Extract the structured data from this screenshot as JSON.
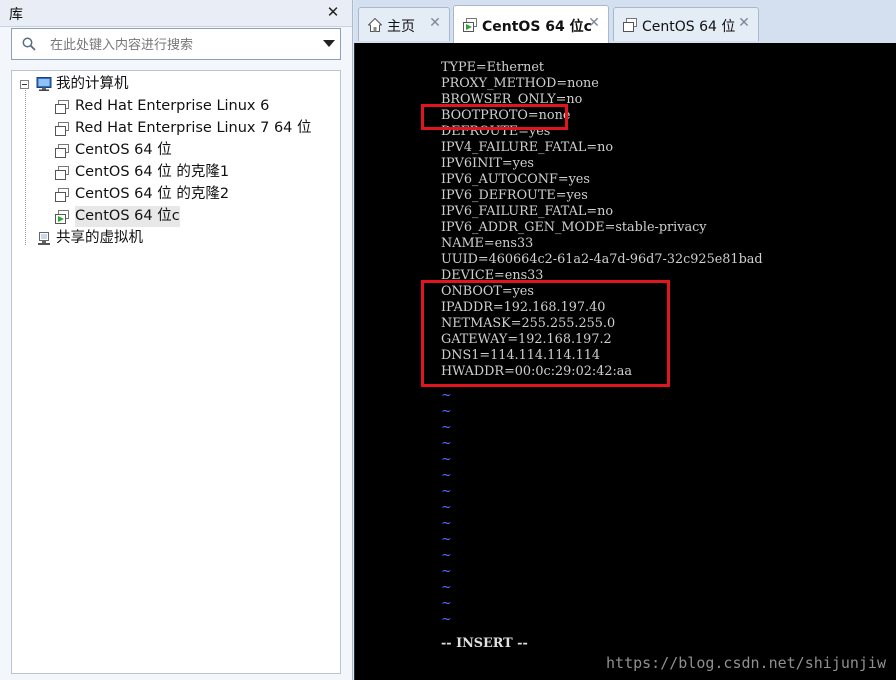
{
  "library": {
    "title": "库",
    "close_glyph": "✕",
    "search": {
      "placeholder": "在此处键入内容进行搜索"
    },
    "tree": {
      "root": {
        "label": "我的计算机",
        "icon": "computer-icon"
      },
      "vms": [
        {
          "label": "Red Hat Enterprise Linux 6",
          "icon": "vm-icon",
          "selected": false
        },
        {
          "label": "Red Hat Enterprise Linux 7 64 位",
          "icon": "vm-icon",
          "selected": false
        },
        {
          "label": "CentOS 64 位",
          "icon": "vm-icon",
          "selected": false
        },
        {
          "label": "CentOS 64 位 的克隆1",
          "icon": "vm-icon",
          "selected": false
        },
        {
          "label": "CentOS 64 位 的克隆2",
          "icon": "vm-icon",
          "selected": false
        },
        {
          "label": "CentOS 64 位c",
          "icon": "vm-running-icon",
          "selected": true
        }
      ],
      "shared": {
        "label": "共享的虚拟机",
        "icon": "shared-vms-icon"
      }
    }
  },
  "tabs": [
    {
      "label": "主页",
      "icon": "home-icon",
      "active": false,
      "close_glyph": "✕"
    },
    {
      "label": "CentOS 64 位c",
      "icon": "vm-running-icon",
      "active": true,
      "close_glyph": "✕"
    },
    {
      "label": "CentOS 64 位",
      "icon": "vm-icon",
      "active": false,
      "close_glyph": "✕"
    }
  ],
  "console": {
    "lines": [
      "TYPE=Ethernet",
      "PROXY_METHOD=none",
      "BROWSER_ONLY=no",
      "BOOTPROTO=none",
      "DEFROUTE=yes",
      "IPV4_FAILURE_FATAL=no",
      "IPV6INIT=yes",
      "IPV6_AUTOCONF=yes",
      "IPV6_DEFROUTE=yes",
      "IPV6_FAILURE_FATAL=no",
      "IPV6_ADDR_GEN_MODE=stable-privacy",
      "NAME=ens33",
      "UUID=460664c2-61a2-4a7d-96d7-32c925e81bad",
      "DEVICE=ens33",
      "ONBOOT=yes",
      "IPADDR=192.168.197.40",
      "NETMASK=255.255.255.0",
      "GATEWAY=192.168.197.2",
      "DNS1=114.114.114.114",
      "HWADDR=00:0c:29:02:42:aa"
    ],
    "tilde": "~",
    "tilde_count": 15,
    "mode": "-- INSERT --",
    "highlight_color": "#e0151e",
    "tilde_color": "#4a6eff"
  },
  "watermark": "https://blog.csdn.net/shijunjiw"
}
